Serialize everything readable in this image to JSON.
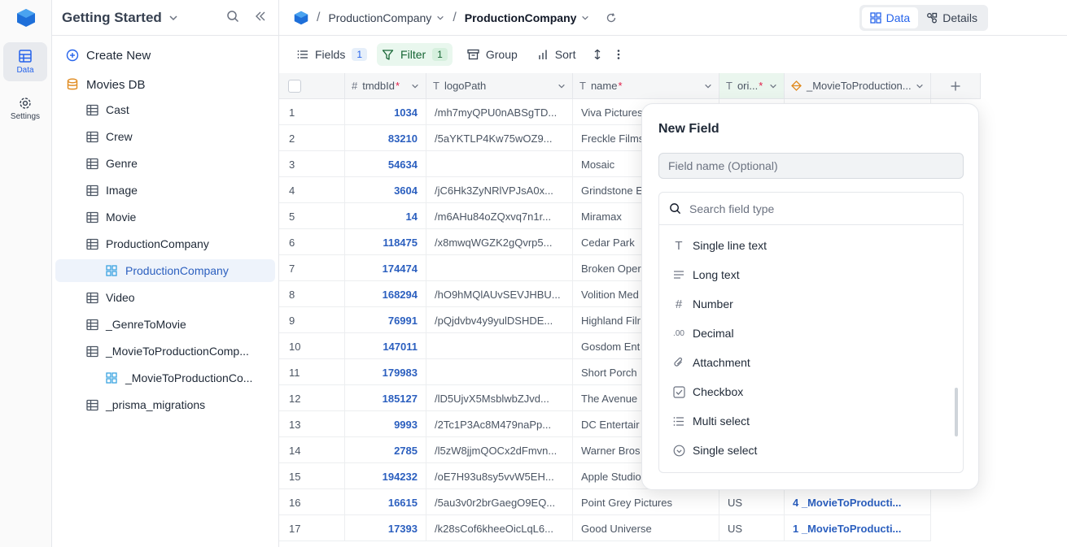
{
  "rail": {
    "items": [
      {
        "label": "Data",
        "icon": "grid-table-icon",
        "active": true
      },
      {
        "label": "Settings",
        "icon": "gear-icon",
        "active": false
      }
    ]
  },
  "sidebar": {
    "title": "Getting Started",
    "create_new": "Create New",
    "db_name": "Movies DB",
    "tables": [
      {
        "label": "Cast",
        "level": 1,
        "icon": "table-icon"
      },
      {
        "label": "Crew",
        "level": 1,
        "icon": "table-icon"
      },
      {
        "label": "Genre",
        "level": 1,
        "icon": "table-icon"
      },
      {
        "label": "Image",
        "level": 1,
        "icon": "table-icon"
      },
      {
        "label": "Movie",
        "level": 1,
        "icon": "table-icon"
      },
      {
        "label": "ProductionCompany",
        "level": 1,
        "icon": "table-icon"
      },
      {
        "label": "ProductionCompany",
        "level": 2,
        "icon": "view-grid-icon",
        "selected": true
      },
      {
        "label": "Video",
        "level": 1,
        "icon": "table-icon"
      },
      {
        "label": "_GenreToMovie",
        "level": 1,
        "icon": "table-icon"
      },
      {
        "label": "_MovieToProductionComp...",
        "level": 1,
        "icon": "table-icon"
      },
      {
        "label": "_MovieToProductionCo...",
        "level": 2,
        "icon": "view-grid-icon"
      },
      {
        "label": "_prisma_migrations",
        "level": 1,
        "icon": "table-icon"
      }
    ]
  },
  "topbar": {
    "crumb_table": "ProductionCompany",
    "crumb_view": "ProductionCompany",
    "toggle_data": "Data",
    "toggle_details": "Details"
  },
  "toolbar": {
    "fields": "Fields",
    "fields_count": "1",
    "filter": "Filter",
    "filter_count": "1",
    "group": "Group",
    "sort": "Sort"
  },
  "grid": {
    "headers": [
      "tmdbId",
      "logoPath",
      "name",
      "ori...",
      "_MovieToProduction..."
    ],
    "rows": [
      {
        "idx": "1",
        "tmdbId": "1034",
        "logoPath": "/mh7myQPU0nABSgTD...",
        "name": "Viva Pictures",
        "origin": "",
        "movies": ""
      },
      {
        "idx": "2",
        "tmdbId": "83210",
        "logoPath": "/5aYKTLP4Kw75wOZ9...",
        "name": "Freckle Films",
        "origin": "",
        "movies": ""
      },
      {
        "idx": "3",
        "tmdbId": "54634",
        "logoPath": "",
        "name": "Mosaic",
        "origin": "",
        "movies": ""
      },
      {
        "idx": "4",
        "tmdbId": "3604",
        "logoPath": "/jC6Hk3ZyNRlVPJsA0x...",
        "name": "Grindstone E",
        "origin": "",
        "movies": ""
      },
      {
        "idx": "5",
        "tmdbId": "14",
        "logoPath": "/m6AHu84oZQxvq7n1r...",
        "name": "Miramax",
        "origin": "",
        "movies": ""
      },
      {
        "idx": "6",
        "tmdbId": "118475",
        "logoPath": "/x8mwqWGZK2gQvrp5...",
        "name": "Cedar Park",
        "origin": "",
        "movies": ""
      },
      {
        "idx": "7",
        "tmdbId": "174474",
        "logoPath": "",
        "name": "Broken Oper",
        "origin": "",
        "movies": ""
      },
      {
        "idx": "8",
        "tmdbId": "168294",
        "logoPath": "/hO9hMQlAUvSEVJHBU...",
        "name": "Volition Med",
        "origin": "",
        "movies": ""
      },
      {
        "idx": "9",
        "tmdbId": "76991",
        "logoPath": "/pQjdvbv4y9yulDSHDE...",
        "name": "Highland Filr",
        "origin": "",
        "movies": ""
      },
      {
        "idx": "10",
        "tmdbId": "147011",
        "logoPath": "",
        "name": "Gosdom Ent",
        "origin": "",
        "movies": ""
      },
      {
        "idx": "11",
        "tmdbId": "179983",
        "logoPath": "",
        "name": "Short Porch",
        "origin": "",
        "movies": ""
      },
      {
        "idx": "12",
        "tmdbId": "185127",
        "logoPath": "/lD5UjvX5MsblwbZJvd...",
        "name": "The Avenue",
        "origin": "",
        "movies": ""
      },
      {
        "idx": "13",
        "tmdbId": "9993",
        "logoPath": "/2Tc1P3Ac8M479naPp...",
        "name": "DC Entertair",
        "origin": "",
        "movies": ""
      },
      {
        "idx": "14",
        "tmdbId": "2785",
        "logoPath": "/l5zW8jjmQOCx2dFmvn...",
        "name": "Warner Bros",
        "origin": "",
        "movies": ""
      },
      {
        "idx": "15",
        "tmdbId": "194232",
        "logoPath": "/oE7H93u8sy5vvW5EH...",
        "name": "Apple Studio",
        "origin": "",
        "movies": ""
      },
      {
        "idx": "16",
        "tmdbId": "16615",
        "logoPath": "/5au3v0r2brGaegO9EQ...",
        "name": "Point Grey Pictures",
        "origin": "US",
        "movies": "4 _MovieToProducti..."
      },
      {
        "idx": "17",
        "tmdbId": "17393",
        "logoPath": "/k28sCof6kheeOicLqL6...",
        "name": "Good Universe",
        "origin": "US",
        "movies": "1 _MovieToProducti..."
      }
    ]
  },
  "popover": {
    "title": "New Field",
    "name_placeholder": "Field name (Optional)",
    "search_placeholder": "Search field type",
    "types": [
      {
        "label": "Single line text",
        "icon": "text-t-icon"
      },
      {
        "label": "Long text",
        "icon": "long-text-icon"
      },
      {
        "label": "Number",
        "icon": "hash-icon"
      },
      {
        "label": "Decimal",
        "icon": "decimal-icon"
      },
      {
        "label": "Attachment",
        "icon": "paperclip-icon"
      },
      {
        "label": "Checkbox",
        "icon": "checkbox-icon"
      },
      {
        "label": "Multi select",
        "icon": "list-icon"
      },
      {
        "label": "Single select",
        "icon": "circle-check-icon"
      }
    ]
  },
  "colors": {
    "accent": "#2563eb",
    "link": "#2b5fbf",
    "filter_bg": "#e9f7ee",
    "required": "#e11d48"
  }
}
